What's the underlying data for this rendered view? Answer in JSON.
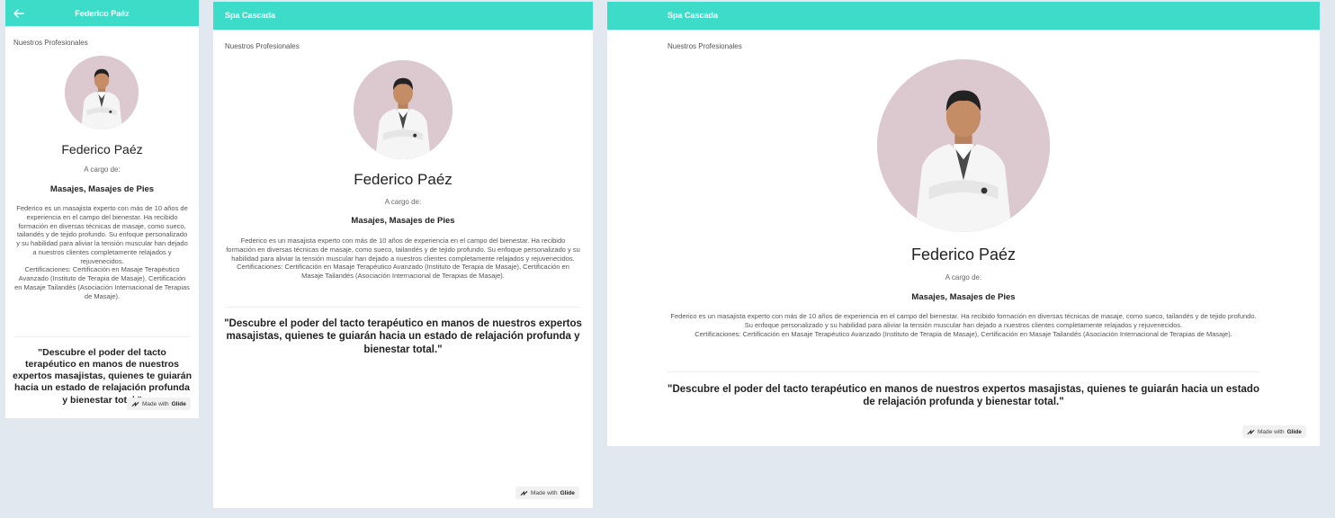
{
  "colors": {
    "accent": "#3cdcc8",
    "background": "#e2e8f0"
  },
  "mobile": {
    "title": "Federico Paéz",
    "back_icon": "arrow-left-icon"
  },
  "app": {
    "name": "Spa Cascada"
  },
  "profile": {
    "section_label": "Nuestros Profesionales",
    "name": "Federico Paéz",
    "charge_label": "A cargo de:",
    "services": "Masajes, Masajes de Pies",
    "bio": "Federico es un masajista experto con más de 10 años de experiencia en el campo del bienestar. Ha recibido formación en diversas técnicas de masaje, como sueco, tailandés y de tejido profundo. Su enfoque personalizado y su habilidad para aliviar la tensión muscular han dejado a nuestros clientes completamente relajados y rejuvenecidos.",
    "certifications": "Certificaciones: Certificación en Masaje Terapéutico Avanzado (Instituto de Terapia de Masaje), Certificación en Masaje Tailandés (Asociación Internacional de Terapias de Masaje).",
    "quote": "\"Descubre el poder del tacto terapéutico en manos de nuestros expertos masajistas, quienes te guiarán hacia un estado de relajación profunda y bienestar total.\""
  },
  "badge": {
    "prefix": "Made with",
    "brand": "Glide",
    "icon": "glide-bolt-icon"
  }
}
